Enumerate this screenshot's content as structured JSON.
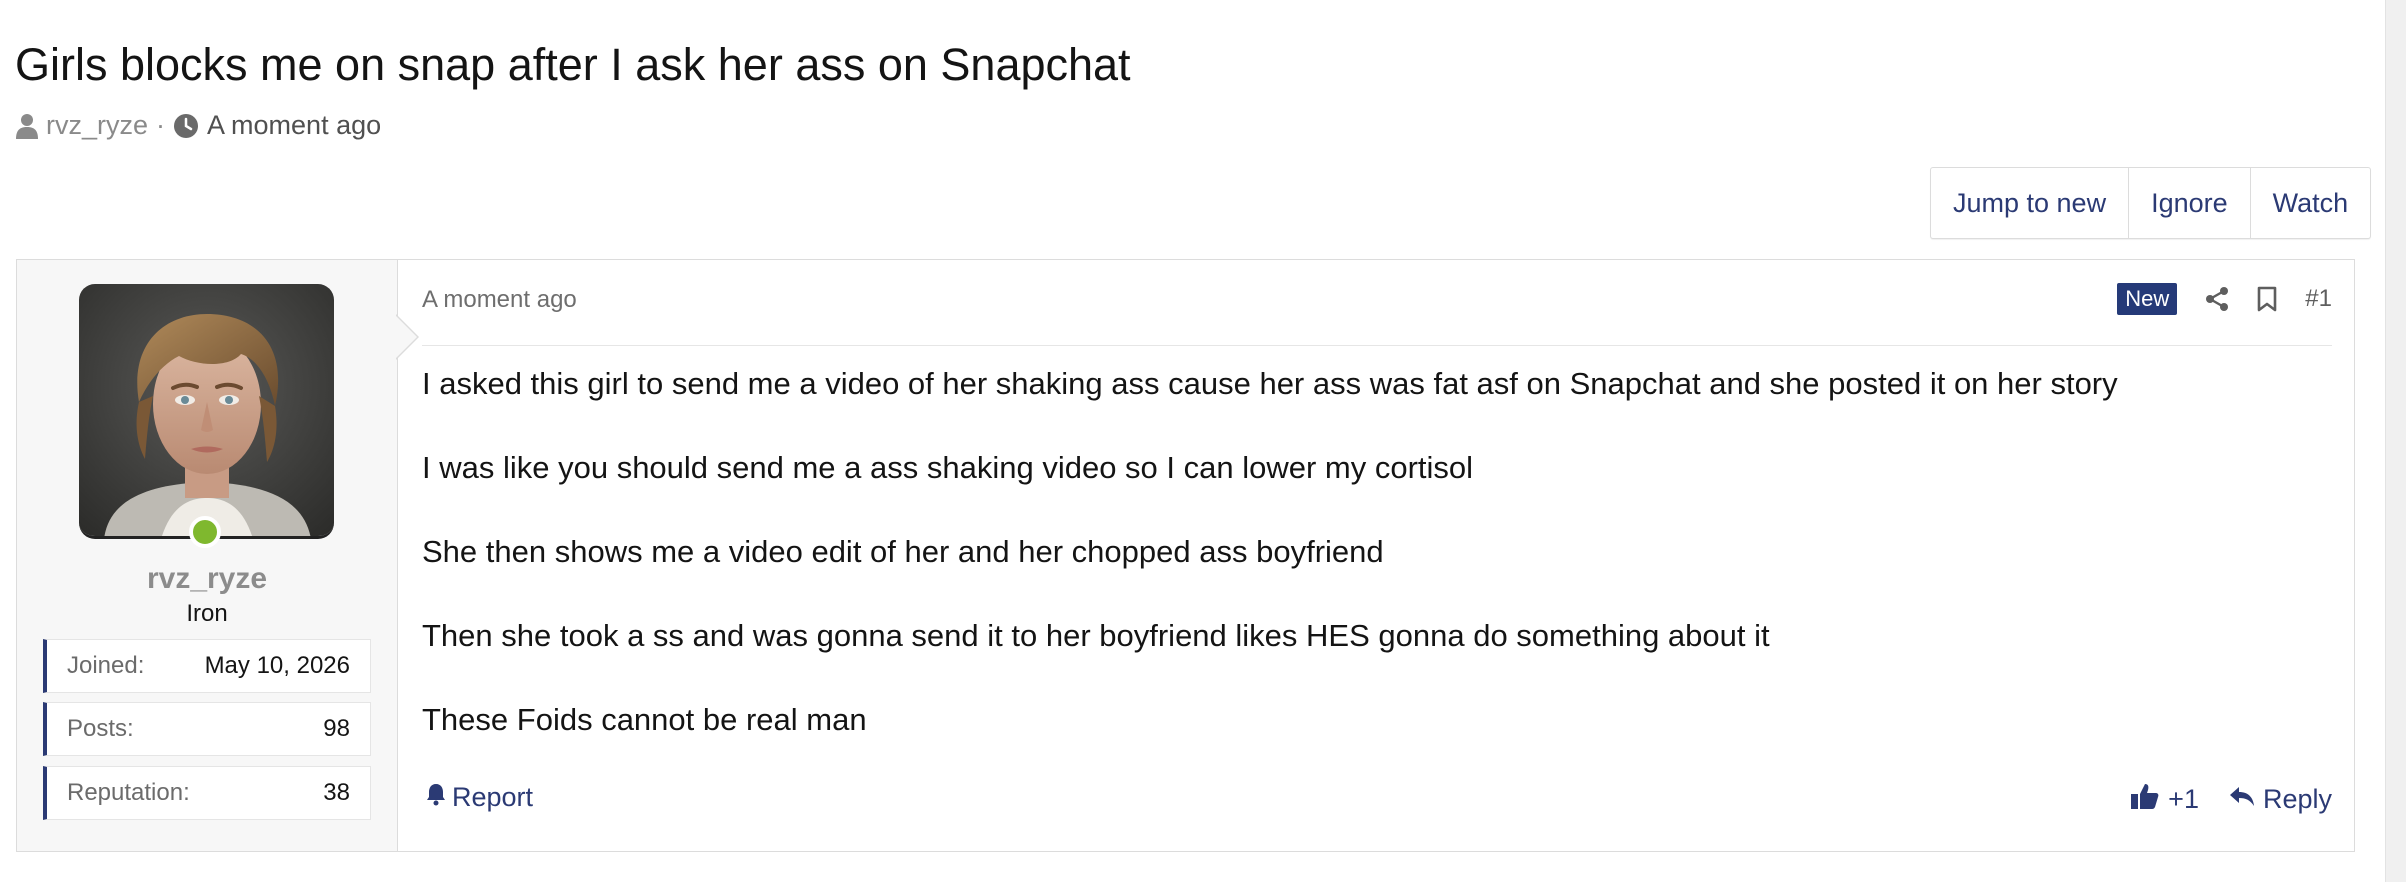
{
  "thread": {
    "title": "Girls blocks me on snap after I ask her ass on Snapchat",
    "author": "rvz_ryze",
    "separator": "·",
    "time": "A moment ago"
  },
  "actions": {
    "jump_to_new": "Jump to new",
    "ignore": "Ignore",
    "watch": "Watch"
  },
  "user": {
    "username": "rvz_ryze",
    "rank": "Iron",
    "online": true,
    "stats": [
      {
        "label": "Joined:",
        "value": "May 10, 2026"
      },
      {
        "label": "Posts:",
        "value": "98"
      },
      {
        "label": "Reputation:",
        "value": "38"
      }
    ]
  },
  "post": {
    "time": "A moment ago",
    "badge": "New",
    "number": "#1",
    "paragraphs": [
      "I asked this girl to send me a video of her shaking ass cause her ass was fat asf on Snapchat and she posted it on her story",
      "I was like you should send me a ass shaking video so I can lower my cortisol",
      "She then shows me a video edit of her and her chopped ass boyfriend",
      "Then she took a ss and was gonna send it to her boyfriend likes HES gonna do something about it",
      "These Foids cannot be real man"
    ],
    "report": "Report",
    "reaction": "+1",
    "reply": "Reply"
  },
  "colors": {
    "accent": "#2b3a74",
    "badge_bg": "#253a78",
    "online": "#7fb82e",
    "muted": "#8a8a8a"
  },
  "icons": {
    "author": "user-icon",
    "time": "clock-icon",
    "share": "share-icon",
    "bookmark": "bookmark-icon",
    "report": "bell-icon",
    "like": "thumbs-up-icon",
    "reply": "reply-icon"
  }
}
